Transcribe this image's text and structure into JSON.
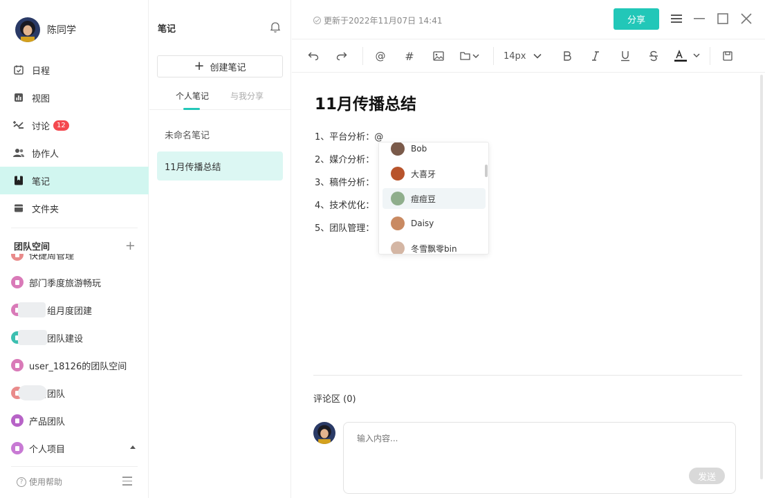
{
  "user": {
    "name": "陈同学"
  },
  "nav": [
    {
      "label": "日程",
      "icon": "calendar-icon"
    },
    {
      "label": "视图",
      "icon": "chart-icon"
    },
    {
      "label": "讨论",
      "icon": "discussion-icon",
      "badge": "12"
    },
    {
      "label": "协作人",
      "icon": "people-icon"
    },
    {
      "label": "笔记",
      "icon": "bookmark-icon",
      "active": true
    },
    {
      "label": "文件夹",
      "icon": "folder-icon"
    }
  ],
  "team_section": {
    "title": "团队空间"
  },
  "teams": [
    {
      "label": "快捷周管理",
      "color": "#e98b8b"
    },
    {
      "label": "部门季度旅游畅玩",
      "color": "#d97ab8"
    },
    {
      "label": "项目组月度团建",
      "color": "#d97ab8"
    },
    {
      "label": "团队团队建设",
      "color": "#3cbfb0"
    },
    {
      "label": "user_18126的团队空间",
      "color": "#d97ab8"
    },
    {
      "label": "运营团队",
      "color": "#e98b8b"
    },
    {
      "label": "产品团队",
      "color": "#b763c7"
    },
    {
      "label": "个人项目",
      "color": "#c87ad4"
    }
  ],
  "help": {
    "label": "使用帮助"
  },
  "notes_panel": {
    "title": "笔记",
    "create_label": "创建笔记",
    "tabs": [
      "个人笔记",
      "与我分享"
    ],
    "notes": [
      {
        "title": "未命名笔记"
      },
      {
        "title": "11月传播总结",
        "active": true
      }
    ]
  },
  "editor": {
    "updated": "更新于2022年11月07日 14:41",
    "share_label": "分享",
    "font_size": "14px",
    "doc_title": "11月传播总结",
    "lines": [
      "1、平台分析：@",
      "2、媒介分析：",
      "3、稿件分析：",
      "4、技术优化：",
      "5、团队管理："
    ],
    "mention_list": [
      {
        "name": "Bob",
        "color": "#7a5a4a"
      },
      {
        "name": "大喜牙",
        "color": "#b8542c"
      },
      {
        "name": "痘痘豆",
        "color": "#8fae8c",
        "hover": true
      },
      {
        "name": "Daisy",
        "color": "#c98a62"
      },
      {
        "name": "冬雪飘零bin",
        "color": "#d4b6a4"
      }
    ],
    "comments": {
      "label": "评论区 (0)",
      "placeholder": "输入内容...",
      "send_label": "发送"
    }
  },
  "colors": {
    "accent": "#22c7b8",
    "active_bg": "#d1f6f0",
    "badge": "#f4494f"
  }
}
